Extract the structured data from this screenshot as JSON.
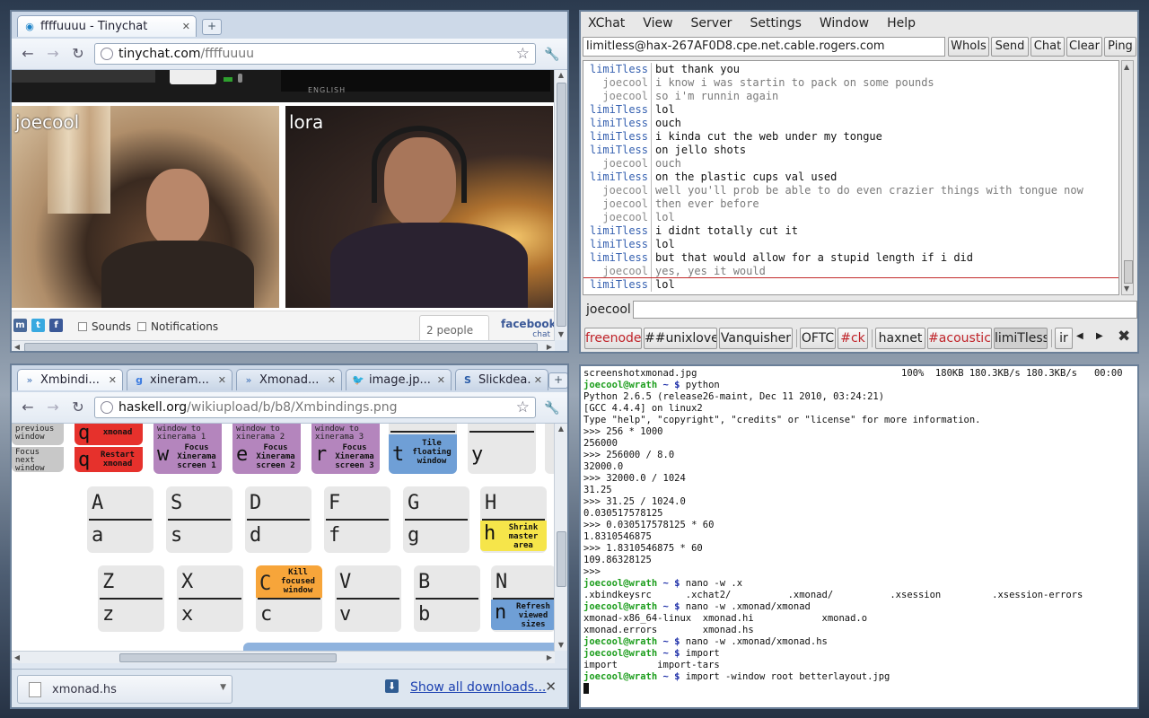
{
  "tinychat": {
    "tab_title": "ffffuuuu - Tinychat",
    "url_host": "tinychat.com",
    "url_path": "/ffffuuuu",
    "language": "ENGLISH",
    "cams": [
      {
        "name": "joecool"
      },
      {
        "name": "lora"
      }
    ],
    "sounds_label": "Sounds",
    "notifications_label": "Notifications",
    "people_count": "2 people",
    "fb_label": "facebook",
    "fb_sub": "chat"
  },
  "haskell": {
    "tabs": [
      "Xmbindi...",
      "xineram...",
      "Xmonad...",
      "image.jp...",
      "Slickdea..."
    ],
    "url_host": "haskell.org",
    "url_path": "/wikiupload/b/b8/Xmbindings.png",
    "top_keys": [
      {
        "title": "previous window",
        "letter": "",
        "desc": ""
      },
      {
        "title": "Focus next window",
        "letter": "",
        "desc": ""
      },
      {
        "title": "",
        "letter": "q",
        "desc": "xmonad"
      },
      {
        "title": "",
        "letter": "q",
        "desc": "Restart xmonad"
      },
      {
        "title": "window to xinerama 1",
        "letter": "w",
        "desc": "Focus Xinerama screen 1"
      },
      {
        "title": "window to xinerama 2",
        "letter": "e",
        "desc": "Focus Xinerama screen 2"
      },
      {
        "title": "window to xinerama 3",
        "letter": "r",
        "desc": "Focus Xinerama screen 3"
      },
      {
        "title": "",
        "letter": "t",
        "desc": "Tile floating window"
      },
      {
        "title": "",
        "letter": "y",
        "desc": ""
      }
    ],
    "row_a": [
      {
        "up": "A",
        "low": "a"
      },
      {
        "up": "S",
        "low": "s"
      },
      {
        "up": "D",
        "low": "d"
      },
      {
        "up": "F",
        "low": "f"
      },
      {
        "up": "G",
        "low": "g"
      },
      {
        "up": "H",
        "low": "h",
        "desc": "Shrink master area"
      }
    ],
    "row_z": [
      {
        "up": "Z",
        "low": "z"
      },
      {
        "up": "X",
        "low": "x"
      },
      {
        "up": "",
        "low": "C",
        "title": "Kill focused window",
        "low2": "c"
      },
      {
        "up": "V",
        "low": "v"
      },
      {
        "up": "B",
        "low": "b"
      },
      {
        "up": "N",
        "low": "n",
        "desc": "Refresh viewed sizes"
      }
    ],
    "download_file": "xmonad.hs",
    "show_all": "Show all downloads..."
  },
  "xchat": {
    "menu": [
      "XChat",
      "View",
      "Server",
      "Settings",
      "Window",
      "Help"
    ],
    "topic": "limitless@hax-267AF0D8.cpe.net.cable.rogers.com",
    "buttons": [
      "WhoIs",
      "Send",
      "Chat",
      "Clear",
      "Ping"
    ],
    "messages": [
      {
        "nick": "limiTless",
        "text": "but thank you"
      },
      {
        "nick": "joecool",
        "text": "i know i was startin to pack on some pounds"
      },
      {
        "nick": "joecool",
        "text": "so i'm runnin again"
      },
      {
        "nick": "limiTless",
        "text": "lol"
      },
      {
        "nick": "limiTless",
        "text": "ouch"
      },
      {
        "nick": "limiTless",
        "text": "i kinda cut the web under my tongue"
      },
      {
        "nick": "limiTless",
        "text": "on jello shots"
      },
      {
        "nick": "joecool",
        "text": "ouch"
      },
      {
        "nick": "limiTless",
        "text": "on the plastic cups val used"
      },
      {
        "nick": "joecool",
        "text": "well you'll prob be able to do even crazier things with tongue now"
      },
      {
        "nick": "joecool",
        "text": "then ever before"
      },
      {
        "nick": "joecool",
        "text": "lol"
      },
      {
        "nick": "limiTless",
        "text": "i didnt totally cut it"
      },
      {
        "nick": "limiTless",
        "text": "lol"
      },
      {
        "nick": "limiTless",
        "text": "but that would allow for a stupid length if i did"
      },
      {
        "nick": "joecool",
        "text": "yes, yes it would"
      },
      {
        "nick": "limiTless",
        "text": "lol"
      }
    ],
    "my_nick": "joecool",
    "channels": [
      "freenode",
      "##unixlove",
      "Vanquisher",
      "OFTC",
      "#ck",
      "haxnet",
      "#acoustic",
      "limiTless",
      "ir"
    ]
  },
  "terminal": {
    "lines": [
      {
        "t": "plain",
        "s": "screenshotxmonad.jpg                                    100%  180KB 180.3KB/s 180.3KB/s   00:00"
      },
      {
        "t": "prompt",
        "user": "joecool@wrath",
        "dir": " ~ $",
        "cmd": " python"
      },
      {
        "t": "plain",
        "s": "Python 2.6.5 (release26-maint, Dec 11 2010, 03:24:21)"
      },
      {
        "t": "plain",
        "s": "[GCC 4.4.4] on linux2"
      },
      {
        "t": "plain",
        "s": "Type \"help\", \"copyright\", \"credits\" or \"license\" for more information."
      },
      {
        "t": "plain",
        "s": ">>> 256 * 1000"
      },
      {
        "t": "plain",
        "s": "256000"
      },
      {
        "t": "plain",
        "s": ">>> 256000 / 8.0"
      },
      {
        "t": "plain",
        "s": "32000.0"
      },
      {
        "t": "plain",
        "s": ">>> 32000.0 / 1024"
      },
      {
        "t": "plain",
        "s": "31.25"
      },
      {
        "t": "plain",
        "s": ">>> 31.25 / 1024.0"
      },
      {
        "t": "plain",
        "s": "0.030517578125"
      },
      {
        "t": "plain",
        "s": ">>> 0.030517578125 * 60"
      },
      {
        "t": "plain",
        "s": "1.8310546875"
      },
      {
        "t": "plain",
        "s": ">>> 1.8310546875 * 60"
      },
      {
        "t": "plain",
        "s": "109.86328125"
      },
      {
        "t": "plain",
        "s": ">>>"
      },
      {
        "t": "prompt",
        "user": "joecool@wrath",
        "dir": " ~ $",
        "cmd": " nano -w .x"
      },
      {
        "t": "plain",
        "s": ".xbindkeysrc      .xchat2/          .xmonad/          .xsession         .xsession-errors"
      },
      {
        "t": "prompt",
        "user": "joecool@wrath",
        "dir": " ~ $",
        "cmd": " nano -w .xmonad/xmonad"
      },
      {
        "t": "plain",
        "s": "xmonad-x86_64-linux  xmonad.hi            xmonad.o"
      },
      {
        "t": "plain",
        "s": "xmonad.errors        xmonad.hs"
      },
      {
        "t": "prompt",
        "user": "joecool@wrath",
        "dir": " ~ $",
        "cmd": " nano -w .xmonad/xmonad.hs"
      },
      {
        "t": "prompt",
        "user": "joecool@wrath",
        "dir": " ~ $",
        "cmd": " import"
      },
      {
        "t": "plain",
        "s": "import       import-tars"
      },
      {
        "t": "prompt",
        "user": "joecool@wrath",
        "dir": " ~ $",
        "cmd": " import -window root betterlayout.jpg"
      },
      {
        "t": "cursor"
      }
    ]
  }
}
